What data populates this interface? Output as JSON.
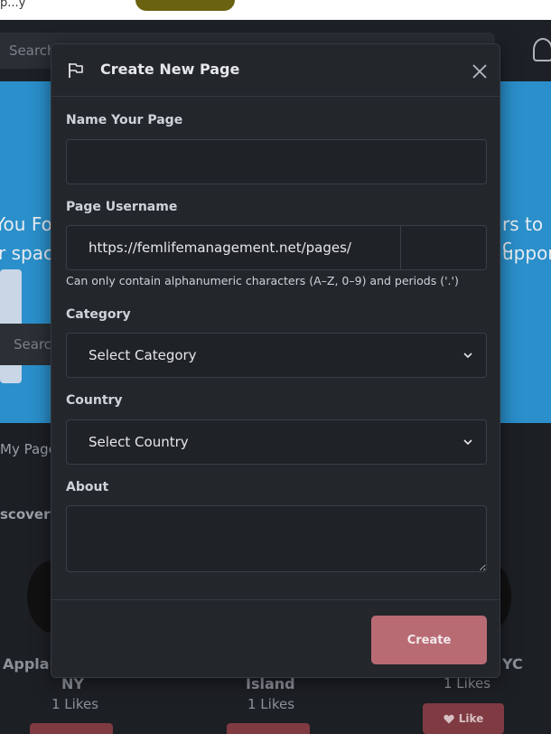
{
  "background": {
    "top_text": "p...y",
    "nav_search_placeholder": "Search",
    "hero_line1_left": "You Fo",
    "hero_line2_left": "r spac",
    "hero_line1_right": "rs to c",
    "hero_line2_right": "upport",
    "hero_search_placeholder": "Searc",
    "my_pages_label": "My Page",
    "discover_label": "scover",
    "cards": [
      {
        "name_line1": "Applau",
        "name_line2": "NY",
        "likes": "1 Likes"
      },
      {
        "name_line1": "",
        "name_line2": "Island",
        "likes": "1 Likes"
      },
      {
        "name_line1": "YC",
        "name_line2": "",
        "likes": "1 Likes"
      }
    ],
    "like_button": "Like"
  },
  "modal": {
    "title": "Create New Page",
    "name_label": "Name Your Page",
    "name_value": "",
    "username_label": "Page Username",
    "username_prefix": "https://femlifemanagement.net/pages/",
    "username_value": "",
    "username_hint": "Can only contain alphanumeric characters (A–Z, 0–9) and periods ('.')",
    "category_label": "Category",
    "category_selected": "Select Category",
    "country_label": "Country",
    "country_selected": "Select Country",
    "about_label": "About",
    "about_value": "",
    "create_button": "Create"
  },
  "colors": {
    "modal_bg": "#23262b",
    "accent": "#b96b74",
    "hero": "#2a8fca"
  }
}
